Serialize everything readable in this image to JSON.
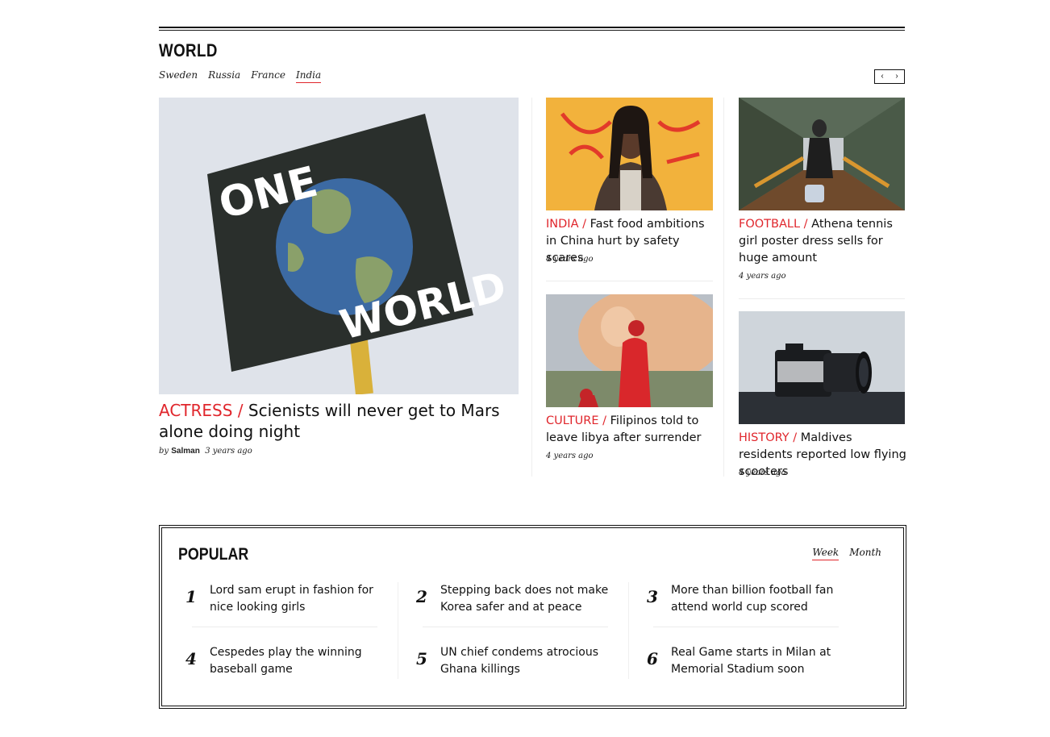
{
  "world": {
    "title": "WORLD",
    "filters": [
      "Sweden",
      "Russia",
      "France",
      "India"
    ],
    "active_filter": "India",
    "pager": {
      "prev": "‹",
      "next": "›"
    },
    "main": {
      "category": "ACTRESS",
      "separator": " / ",
      "headline": "Scienists will never get to Mars alone doing night",
      "by": "by",
      "author": "Salman",
      "time": "3 years ago",
      "image_text_top": "ONE",
      "image_text_bottom": "WORLD"
    },
    "cards": [
      {
        "category": "INDIA",
        "headline": "Fast food ambitions in China hurt by safety scares",
        "time": "4 years ago"
      },
      {
        "category": "FOOTBALL",
        "headline": "Athena tennis girl poster dress sells for huge amount",
        "time": "4 years ago"
      },
      {
        "category": "CULTURE",
        "headline": "Filipinos told to leave libya after surrender",
        "time": "4 years ago"
      },
      {
        "category": "HISTORY",
        "headline": "Maldives residents reported low flying scooters",
        "time": "4 years ago"
      }
    ]
  },
  "popular": {
    "title": "POPULAR",
    "tabs": [
      "Week",
      "Month"
    ],
    "active_tab": "Week",
    "items": [
      {
        "num": "1",
        "text": "Lord sam erupt in fashion for nice looking girls"
      },
      {
        "num": "2",
        "text": "Stepping back does not make Korea safer and at peace"
      },
      {
        "num": "3",
        "text": "More than billion football fan attend world cup scored"
      },
      {
        "num": "4",
        "text": "Cespedes play the winning baseball game"
      },
      {
        "num": "5",
        "text": "UN chief condems atrocious Ghana killings"
      },
      {
        "num": "6",
        "text": "Real Game starts in Milan at Memorial Stadium soon"
      }
    ]
  },
  "colors": {
    "accent": "#e0262c",
    "text": "#111111"
  }
}
